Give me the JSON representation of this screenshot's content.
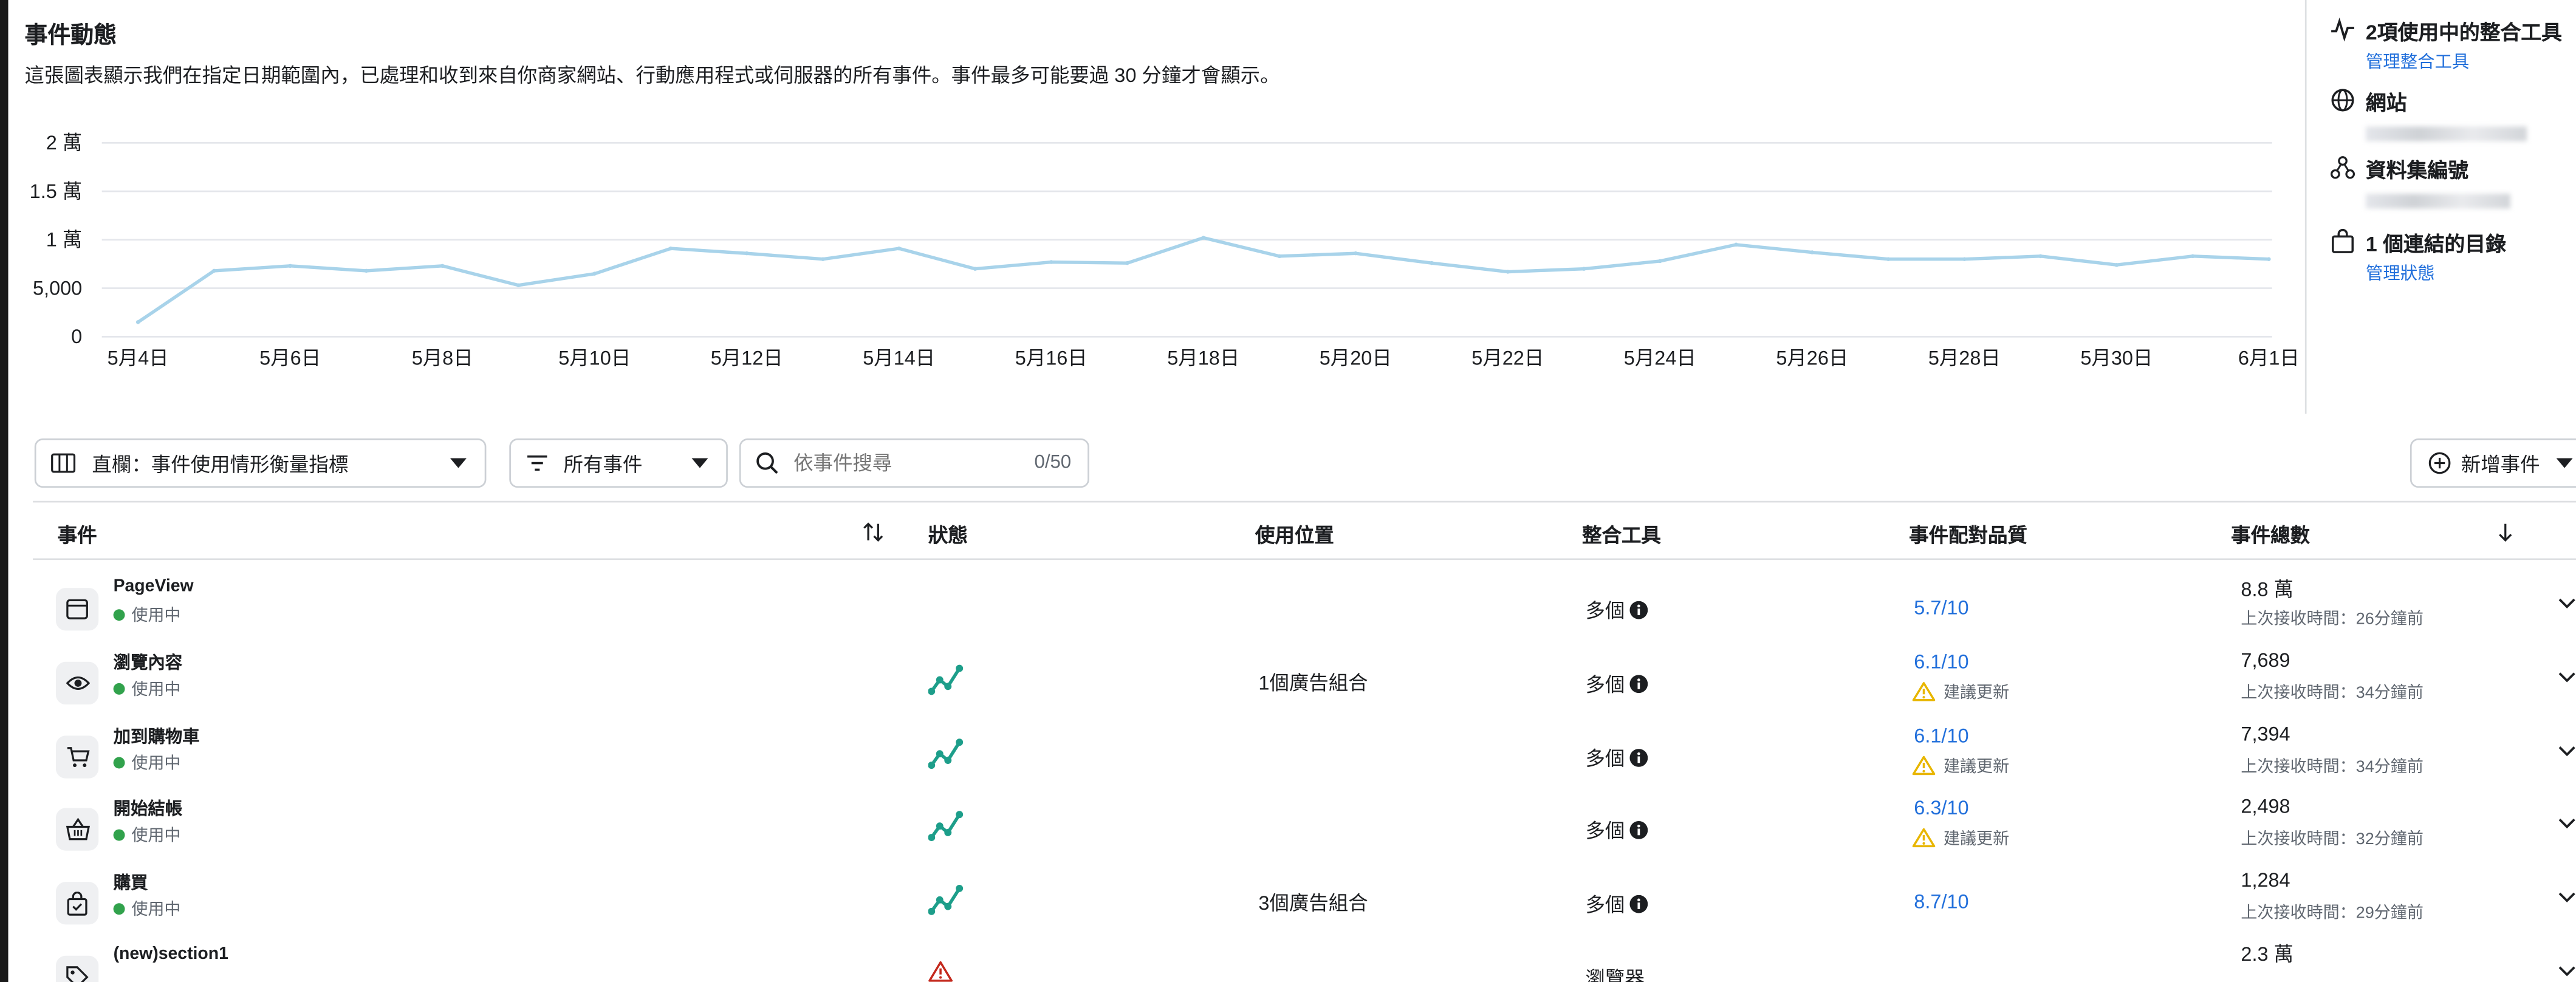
{
  "header": {
    "title": "事件動態",
    "description": "這張圖表顯示我們在指定日期範圍內，已處理和收到來自你商家網站、行動應用程式或伺服器的所有事件。事件最多可能要過 30 分鐘才會顯示。"
  },
  "chart_data": {
    "type": "line",
    "x": [
      "5月4日",
      "5月5日",
      "5月6日",
      "5月7日",
      "5月8日",
      "5月9日",
      "5月10日",
      "5月11日",
      "5月12日",
      "5月13日",
      "5月14日",
      "5月15日",
      "5月16日",
      "5月17日",
      "5月18日",
      "5月19日",
      "5月20日",
      "5月21日",
      "5月22日",
      "5月23日",
      "5月24日",
      "5月25日",
      "5月26日",
      "5月27日",
      "5月28日",
      "5月29日",
      "5月30日",
      "5月31日",
      "6月1日"
    ],
    "x_tick_labels": [
      "5月4日",
      "5月6日",
      "5月8日",
      "5月10日",
      "5月12日",
      "5月14日",
      "5月16日",
      "5月18日",
      "5月20日",
      "5月22日",
      "5月24日",
      "5月26日",
      "5月28日",
      "5月30日",
      "6月1日"
    ],
    "y_tick_labels": [
      "0",
      "5,000",
      "1 萬",
      "1.5 萬",
      "2 萬"
    ],
    "y_tick_values": [
      0,
      5000,
      10000,
      15000,
      20000
    ],
    "ylim": [
      0,
      20000
    ],
    "grid": true,
    "color": "#a8d3ea",
    "series": [
      {
        "values": [
          1500,
          6800,
          7300,
          6800,
          7300,
          5300,
          6500,
          9100,
          8600,
          8000,
          9100,
          7000,
          7700,
          7600,
          10200,
          8300,
          8600,
          7600,
          6700,
          7000,
          7800,
          9500,
          8700,
          8000,
          8000,
          8300,
          7400,
          8300,
          8000
        ]
      }
    ]
  },
  "sidebar": {
    "integrations": {
      "title": "2項使用中的整合工具",
      "link": "管理整合工具",
      "icon": "activity-icon"
    },
    "website": {
      "title": "網站",
      "icon": "globe-icon"
    },
    "dataset": {
      "title": "資料集編號",
      "icon": "dataset-icon"
    },
    "catalog": {
      "title": "1 個連結的目錄",
      "link": "管理狀態",
      "icon": "catalog-bag-icon"
    }
  },
  "controls": {
    "columns_label": "直欄：事件使用情形衡量指標",
    "filter_label": "所有事件",
    "search_placeholder": "依事件搜尋",
    "search_count": "0/50",
    "add_event_label": "新增事件"
  },
  "table": {
    "headers": {
      "event": "事件",
      "status": "狀態",
      "usage": "使用位置",
      "integration": "整合工具",
      "quality": "事件配對品質",
      "total": "事件總數"
    },
    "rows": [
      {
        "name": "PageView",
        "status": "使用中",
        "icon": "browser-window-icon",
        "usage": "",
        "integration": "多個",
        "quality": "5.7/10",
        "quality_note": "",
        "total": "8.8 萬",
        "last": "上次接收時間：26分鐘前",
        "trend": false
      },
      {
        "name": "瀏覽內容",
        "status": "使用中",
        "icon": "eye-icon",
        "usage": "1個廣告組合",
        "integration": "多個",
        "quality": "6.1/10",
        "quality_note": "建議更新",
        "total": "7,689",
        "last": "上次接收時間：34分鐘前",
        "trend": true
      },
      {
        "name": "加到購物車",
        "status": "使用中",
        "icon": "cart-icon",
        "usage": "",
        "integration": "多個",
        "quality": "6.1/10",
        "quality_note": "建議更新",
        "total": "7,394",
        "last": "上次接收時間：34分鐘前",
        "trend": true
      },
      {
        "name": "開始結帳",
        "status": "使用中",
        "icon": "basket-icon",
        "usage": "",
        "integration": "多個",
        "quality": "6.3/10",
        "quality_note": "建議更新",
        "total": "2,498",
        "last": "上次接收時間：32分鐘前",
        "trend": true
      },
      {
        "name": "購買",
        "status": "使用中",
        "icon": "shopping-bag-icon",
        "usage": "3個廣告組合",
        "integration": "多個",
        "quality": "8.7/10",
        "quality_note": "",
        "total": "1,284",
        "last": "上次接收時間：29分鐘前",
        "trend": true
      },
      {
        "name": "(new)section1",
        "status": "",
        "icon": "tag-icon",
        "usage": "",
        "integration": "瀏覽器",
        "quality": "",
        "quality_note": "",
        "total": "2.3 萬",
        "last": "",
        "trend": false,
        "warning": true
      }
    ]
  },
  "colors": {
    "accent": "#216fdb",
    "active": "#31a24c",
    "trend": "#1d9e8a",
    "warning": "#e8b600",
    "error": "#c4281c"
  }
}
